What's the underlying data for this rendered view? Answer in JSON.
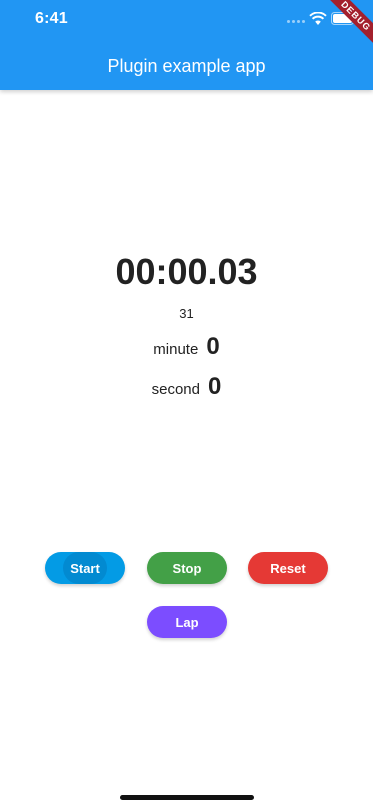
{
  "status_bar": {
    "time": "6:41",
    "icons": [
      "signal-icon",
      "wifi-icon",
      "battery-icon"
    ]
  },
  "debug_banner": "DEBUG",
  "app_bar": {
    "title": "Plugin example app",
    "color": "#2196f3"
  },
  "timer": {
    "display": "00:00.03",
    "raw": "31",
    "minute_label": "minute",
    "minute_value": "0",
    "second_label": "second",
    "second_value": "0"
  },
  "buttons": {
    "start": {
      "label": "Start",
      "color": "#039be5"
    },
    "stop": {
      "label": "Stop",
      "color": "#43a047"
    },
    "reset": {
      "label": "Reset",
      "color": "#e53935"
    },
    "lap": {
      "label": "Lap",
      "color": "#7c4dff"
    }
  }
}
